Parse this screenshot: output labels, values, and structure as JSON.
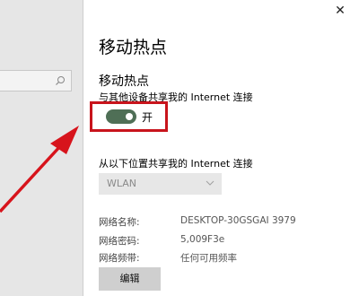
{
  "panel": {
    "close_glyph": "✕",
    "page_title": "移动热点",
    "section1_title": "移动热点",
    "section1_desc": "与其他设备共享我的 Internet 连接",
    "toggle": {
      "state": "on",
      "label": "开"
    },
    "section2_desc": "从以下位置共享我的 Internet 连接",
    "connection_select": {
      "value": "WLAN"
    },
    "details": [
      {
        "key": "网络名称:",
        "value": "DESKTOP-30GSGAI 3979"
      },
      {
        "key": "网络密码:",
        "value": "5,009F3e"
      },
      {
        "key": "网络频带:",
        "value": "任何可用频率"
      }
    ],
    "edit_button": "编辑"
  },
  "colors": {
    "toggle_on": "#4f6f56",
    "highlight": "#c8141c",
    "arrow": "#d7141c"
  },
  "icons": [
    "search-icon",
    "close-icon",
    "chevron-down-icon",
    "annotation-arrow"
  ]
}
